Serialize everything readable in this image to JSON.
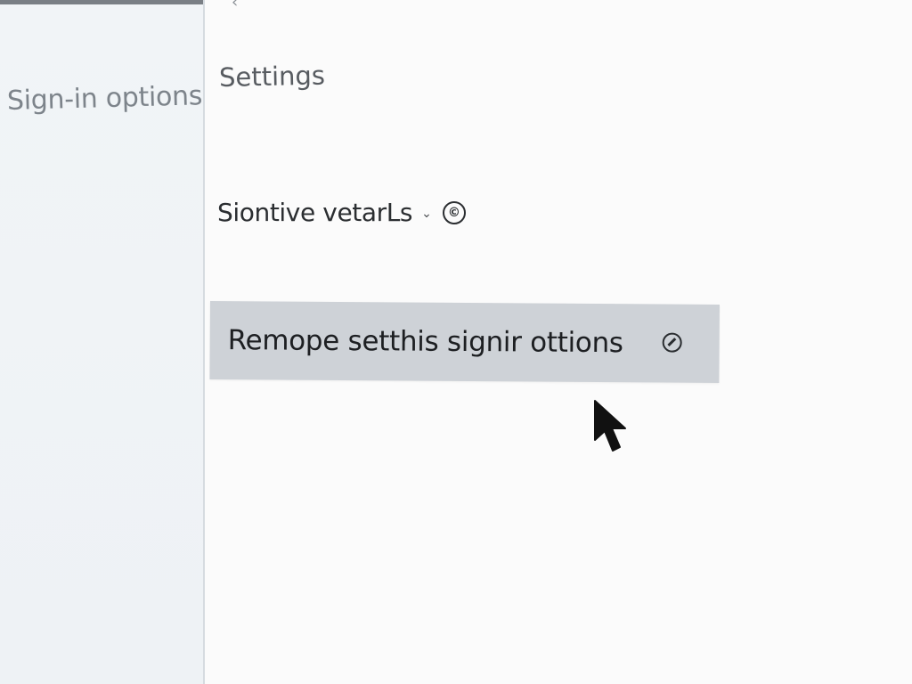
{
  "sidebar": {
    "item_label": "Sign-in options"
  },
  "main": {
    "title": "Settings",
    "dropdown": {
      "label": "Siontive vetarLs",
      "chevron_icon": "chevron-down-icon",
      "info_icon": "info-icon",
      "info_glyph": "©"
    },
    "remove_option": {
      "label": "Remope setthis signir ottions",
      "icon": "block-icon"
    }
  },
  "colors": {
    "sidebar_bg": "#eef2f5",
    "highlight_bg": "#ced2d7",
    "text_dark": "#1d1f22",
    "text_muted": "#7d848b"
  }
}
